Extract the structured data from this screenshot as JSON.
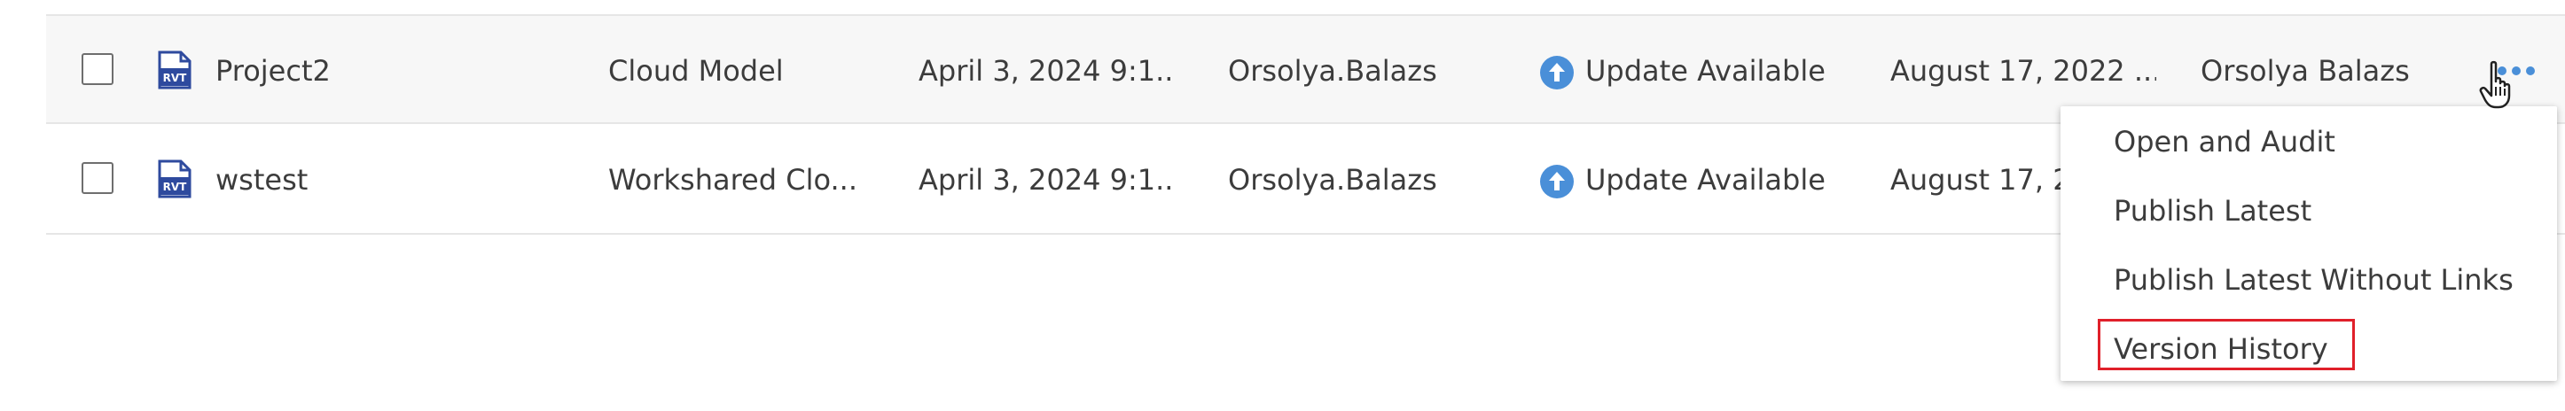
{
  "rows": [
    {
      "file_icon": "rvt-file-icon",
      "file_icon_text": "RVT",
      "name": "Project2",
      "type": "Cloud Model",
      "modified": "April 3, 2024 9:1...",
      "modified_by": "Orsolya.Balazs",
      "status_icon": "upload-arrow-icon",
      "status": "Update Available",
      "created": "August 17, 2022 ...",
      "created_by": "Orsolya Balazs"
    },
    {
      "file_icon": "rvt-file-icon",
      "file_icon_text": "RVT",
      "name": "wstest",
      "type": "Workshared Clo...",
      "modified": "April 3, 2024 9:1...",
      "modified_by": "Orsolya.Balazs",
      "status_icon": "upload-arrow-icon",
      "status": "Update Available",
      "created": "August 17, 20"
    }
  ],
  "context_menu": {
    "items": [
      "Open and Audit",
      "Publish Latest",
      "Publish Latest Without Links",
      "Version History"
    ],
    "highlighted_item": "Version History"
  },
  "colors": {
    "accent": "#4a8fd8",
    "file_icon": "#2e4a9e",
    "highlight": "#e0202a",
    "row_hover": "#f7f7f7",
    "divider": "#e6e6e6"
  },
  "icons": {
    "more": "more-horizontal-icon",
    "cursor": "hand-pointer-icon"
  }
}
